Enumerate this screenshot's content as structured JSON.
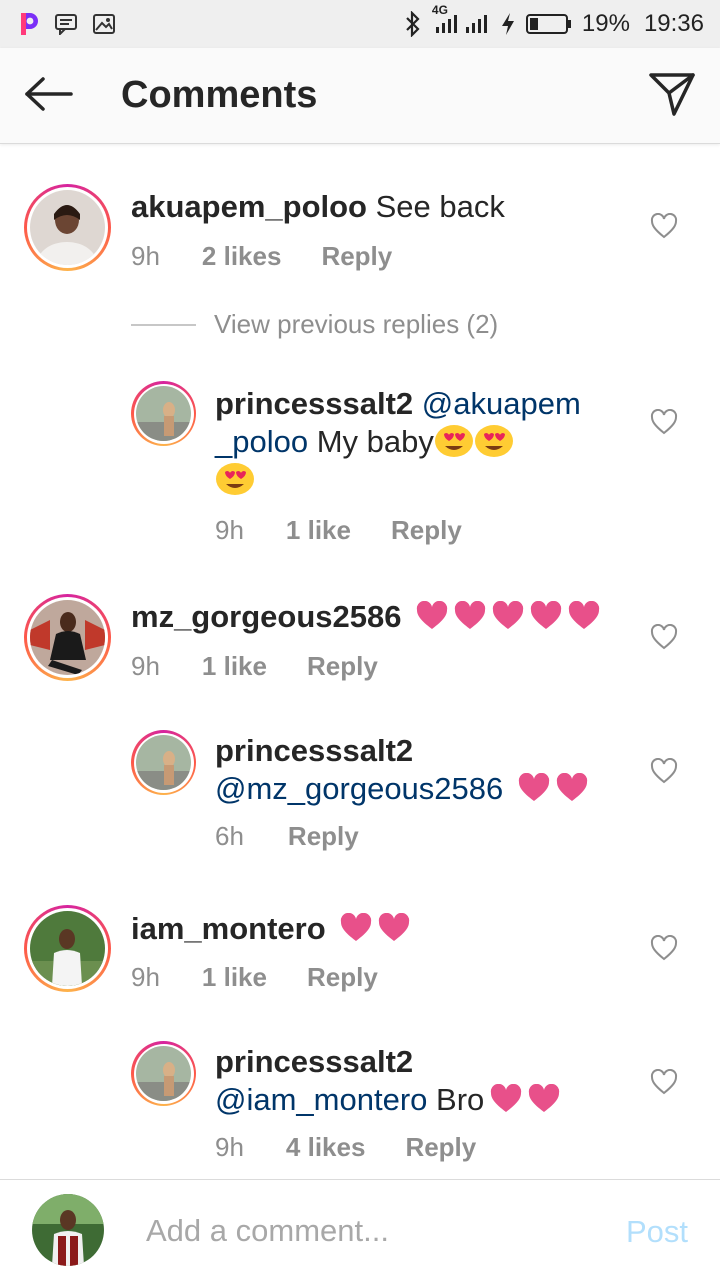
{
  "status_bar": {
    "network": "4G",
    "battery": "19%",
    "time": "19:36"
  },
  "header": {
    "title": "Comments",
    "back_icon": "arrow-left-icon",
    "send_icon": "paper-plane-icon"
  },
  "comments": [
    {
      "username": "akuapem_poloo",
      "text": "See back",
      "time": "9h",
      "likes": "2 likes",
      "reply_label": "Reply",
      "view_previous": "View previous replies (2)"
    },
    {
      "username": "princesssalt2",
      "mention": "@akuapem _poloo",
      "text": "My baby",
      "emoji": "smiling-face-with-heart-eyes",
      "time": "9h",
      "likes": "1 like",
      "reply_label": "Reply"
    },
    {
      "username": "mz_gorgeous2586",
      "emoji": "pink-heart",
      "time": "9h",
      "likes": "1 like",
      "reply_label": "Reply"
    },
    {
      "username": "princesssalt2",
      "mention": "@mz_gorgeous2586",
      "emoji": "pink-heart",
      "time": "6h",
      "reply_label": "Reply"
    },
    {
      "username": "iam_montero",
      "emoji": "pink-heart",
      "time": "9h",
      "likes": "1 like",
      "reply_label": "Reply"
    },
    {
      "username": "princesssalt2",
      "mention": "@iam_montero",
      "text": "Bro",
      "emoji": "pink-heart",
      "time": "9h",
      "likes": "4 likes",
      "reply_label": "Reply"
    }
  ],
  "composer": {
    "placeholder": "Add a comment...",
    "post_label": "Post"
  },
  "colors": {
    "mention": "#003569",
    "meta": "#8e8e8e",
    "post_disabled": "#b2dffc",
    "heart": "#e8508a"
  }
}
